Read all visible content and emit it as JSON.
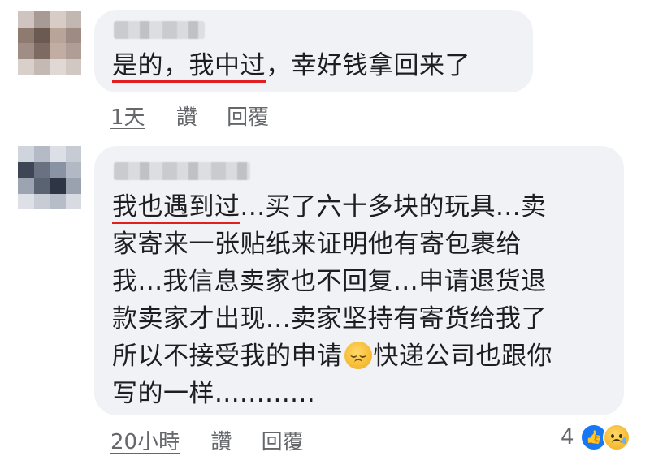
{
  "comments": [
    {
      "lines": [
        {
          "highlight": "是的，我中过",
          "rest": "，幸好钱拿回来了"
        }
      ],
      "time": "1天",
      "like_label": "讚",
      "reply_label": "回覆"
    },
    {
      "lines": [
        {
          "highlight": "我也遇到过",
          "rest": "...买了六十多块的玩具...卖"
        },
        {
          "highlight": "",
          "rest": "家寄来一张贴纸来证明他有寄包裹给"
        },
        {
          "highlight": "",
          "rest": "我...我信息卖家也不回复...申请退货退"
        },
        {
          "highlight": "",
          "rest": "款卖家才出现...卖家坚持有寄货给我了"
        }
      ],
      "line5_before": "所以不接受我的申请",
      "line5_emoji": "pensive-face-emoji",
      "line5_after": "快递公司也跟你",
      "line6": "写的一样............",
      "time": "20小時",
      "like_label": "讚",
      "reply_label": "回覆",
      "reaction_count": "4",
      "reaction_icons": [
        "like-icon",
        "sad-face-icon"
      ]
    }
  ],
  "colors": {
    "bubble": "#f0f2f5",
    "underline": "#e02020",
    "meta_text": "#65676b",
    "like_blue": "#1877f2"
  }
}
